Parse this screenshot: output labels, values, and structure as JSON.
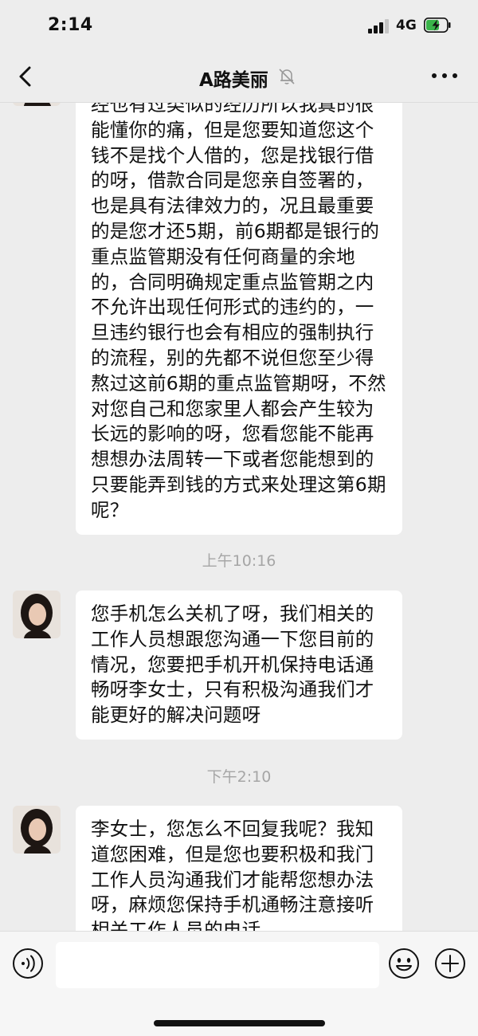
{
  "status_bar": {
    "time": "2:14",
    "network": "4G"
  },
  "header": {
    "title": "A路美丽"
  },
  "messages": [
    {
      "type": "bubble",
      "text": "经也有过类似的经历所以我真的很能懂你的痛，但是您要知道您这个钱不是找个人借的，您是找银行借的呀，借款合同是您亲自签署的，也是具有法律效力的，况且最重要的是您才还5期，前6期都是银行的重点监管期没有任何商量的余地的，合同明确规定重点监管期之内不允许出现任何形式的违约的，一旦违约银行也会有相应的强制执行的流程，别的先都不说但您至少得熬过这前6期的重点监管期呀，不然对您自己和您家里人都会产生较为长远的影响的呀，您看您能不能再想想办法周转一下或者您能想到的只要能弄到钱的方式来处理这第6期呢？"
    },
    {
      "type": "time",
      "text": "上午10:16"
    },
    {
      "type": "bubble",
      "text": "您手机怎么关机了呀，我们相关的工作人员想跟您沟通一下您目前的情况，您要把手机开机保持电话通畅呀李女士，只有积极沟通我们才能更好的解决问题呀"
    },
    {
      "type": "time",
      "text": "下午2:10"
    },
    {
      "type": "bubble",
      "text": "李女士，您怎么不回复我呢？我知道您困难，但是您也要积极和我门工作人员沟通我们才能帮您想办法呀，麻烦您保持手机通畅注意接听相关工作人员的电话"
    }
  ],
  "colors": {
    "background": "#ededed",
    "bubble": "#ffffff",
    "timestamp": "#a6a6a6",
    "battery_charge": "#3ab44a"
  },
  "icons": [
    "back-icon",
    "mute-icon",
    "more-icon",
    "voice-icon",
    "emoji-icon",
    "plus-icon"
  ]
}
